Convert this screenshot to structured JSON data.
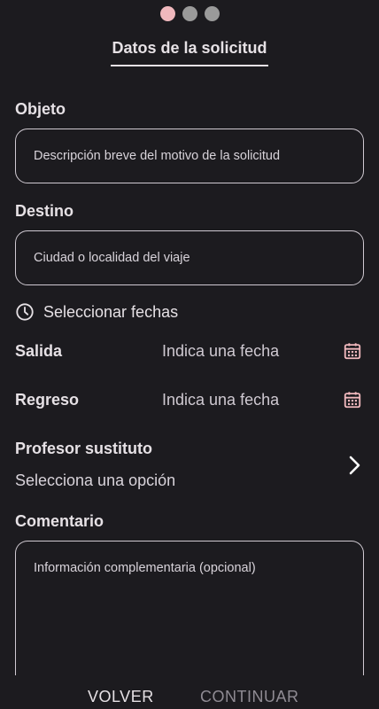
{
  "stepper": {
    "total": 3,
    "active_index": 0,
    "colors": {
      "active": "#f0b8bd",
      "inactive": "#9a9a9a"
    }
  },
  "header": {
    "title": "Datos de la solicitud"
  },
  "form": {
    "objeto": {
      "label": "Objeto",
      "placeholder": "Descripción breve del motivo de la solicitud"
    },
    "destino": {
      "label": "Destino",
      "placeholder": "Ciudad o localidad del viaje"
    },
    "dates_toggle": {
      "label": "Seleccionar fechas",
      "icon": "clock-icon"
    },
    "salida": {
      "label": "Salida",
      "value": "Indica una fecha",
      "icon": "calendar-icon"
    },
    "regreso": {
      "label": "Regreso",
      "value": "Indica una fecha",
      "icon": "calendar-icon"
    },
    "profesor": {
      "label": "Profesor sustituto",
      "value": "Selecciona una opción",
      "icon": "chevron-right-icon"
    },
    "comentario": {
      "label": "Comentario",
      "placeholder": "Información complementaria (opcional)"
    }
  },
  "footer": {
    "back_label": "VOLVER",
    "continue_label": "CONTINUAR"
  },
  "theme": {
    "background": "#1c1b1f",
    "accent": "#f0b8bd",
    "text": "#e6e1e5"
  }
}
